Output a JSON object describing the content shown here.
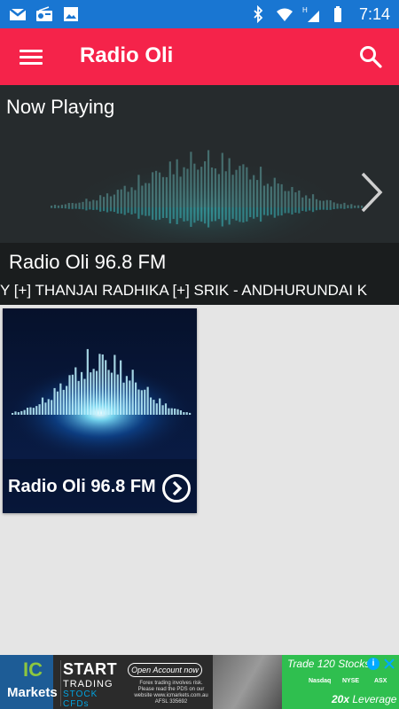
{
  "status_bar": {
    "time": "7:14",
    "network": "H",
    "left_icons": [
      "gmail-icon",
      "radio-icon",
      "image-icon"
    ],
    "right_icons": [
      "bluetooth-icon",
      "wifi-icon",
      "signal-icon",
      "battery-icon"
    ]
  },
  "app_bar": {
    "title": "Radio Oli",
    "background": "#f5234a"
  },
  "now_playing": {
    "heading": "Now Playing",
    "station_name": "Radio Oli 96.8 FM",
    "ticker": "Y [+] THANJAI RADHIKA [+] SRIK  -  ANDHURUNDAI K"
  },
  "stations": [
    {
      "name": "Radio Oli 96.8 FM"
    }
  ],
  "ad": {
    "logo_top": "IC",
    "logo_bottom": "Markets",
    "headline": "START",
    "sub1": "TRADING",
    "sub2": "STOCK CFDs",
    "cta": "Open Account now",
    "fine_print": "Forex trading involves risk. Please read the PDS on our website www.icmarkets.com.au AFSL 335692",
    "promo_prefix": "Trade",
    "promo_count": "120",
    "promo_suffix": "Stocks",
    "exchanges": [
      "Nasdaq",
      "NYSE",
      "ASX"
    ],
    "leverage_value": "20x",
    "leverage_label": "Leverage"
  }
}
